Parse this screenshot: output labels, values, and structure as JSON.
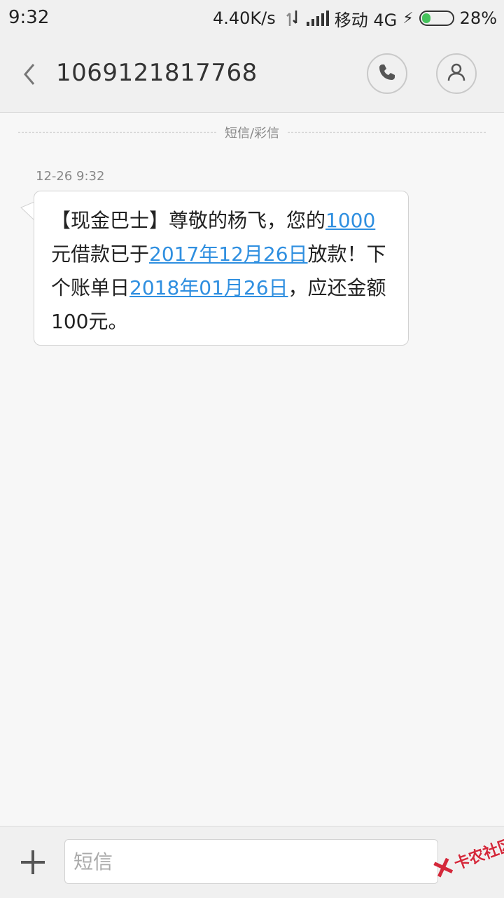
{
  "status_bar": {
    "time": "9:32",
    "speed": "4.40K/s",
    "carrier": "移动 4G",
    "battery": "28%",
    "battery_level": 0.28
  },
  "header": {
    "back_icon": "chevron-left-icon",
    "title": "1069121817768",
    "call_icon": "phone-icon",
    "contact_icon": "person-icon"
  },
  "thread": {
    "divider_label": "短信/彩信",
    "message": {
      "time": "12-26 9:32",
      "parts": [
        {
          "text": "【现金巴士】尊敬的杨飞，您的",
          "link": false
        },
        {
          "text": "1000",
          "link": true
        },
        {
          "text": "元借款已于",
          "link": false
        },
        {
          "text": "2017年12月26日",
          "link": true
        },
        {
          "text": "放款！下个账单日",
          "link": false
        },
        {
          "text": "2018年01月26日",
          "link": true
        },
        {
          "text": "，应还金额100元。",
          "link": false
        }
      ]
    }
  },
  "compose": {
    "add_icon": "plus-icon",
    "placeholder": "短信",
    "value": ""
  },
  "watermark": {
    "text": "卡农社区",
    "accent": "#d4283a"
  },
  "colors": {
    "link": "#2f8fe0",
    "battery_fill": "#44c25b"
  }
}
